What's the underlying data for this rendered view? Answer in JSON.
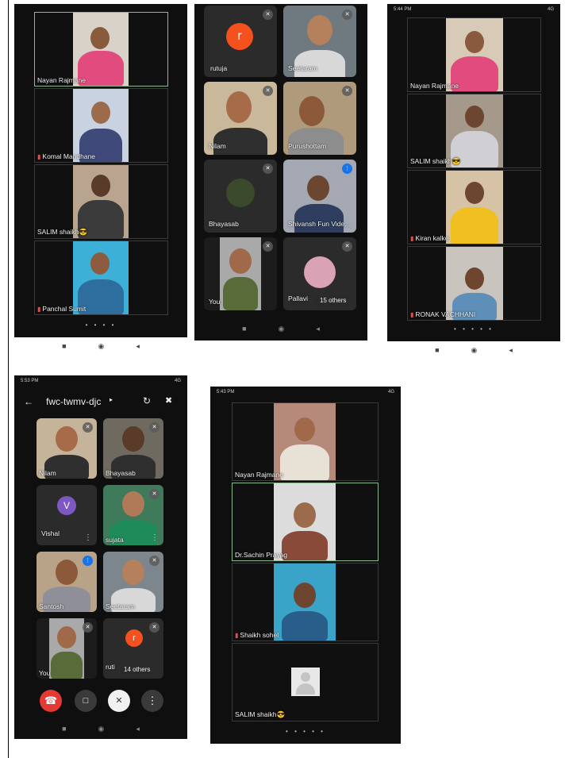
{
  "phone1": {
    "tiles": [
      {
        "name": "Nayan Rajmane"
      },
      {
        "name": "Komal Mandhane"
      },
      {
        "name": "SALIM shaikh😎"
      },
      {
        "name": "Panchal Sumit"
      }
    ],
    "page_dots": "• • • •"
  },
  "phone2": {
    "tiles": [
      {
        "name": "rutuja",
        "initial": "r"
      },
      {
        "name": "Seetaram"
      },
      {
        "name": "Nilam"
      },
      {
        "name": "Purushottam"
      },
      {
        "name": "Bhayasab"
      },
      {
        "name": "Shivansh Fun Vide..."
      },
      {
        "name": "You"
      },
      {
        "name": "Pallavi"
      }
    ],
    "others": "15 others"
  },
  "phone3": {
    "status_time": "5:44 PM",
    "status_right": "4G",
    "tiles": [
      {
        "name": "Nayan Rajmane"
      },
      {
        "name": "SALIM shaikh😎"
      },
      {
        "name": "Kiran kalke"
      },
      {
        "name": "RONAK VACHHANI"
      }
    ],
    "page_dots": "• • • • •"
  },
  "phone4": {
    "status_time": "5:53 PM",
    "status_right": "4G",
    "meeting_code": "fwc-twmv-djc",
    "tiles": [
      {
        "name": "Nilam"
      },
      {
        "name": "Bhayasab"
      },
      {
        "name": "Vishal",
        "initial": "V"
      },
      {
        "name": "sujata"
      },
      {
        "name": "Santosh"
      },
      {
        "name": "Seetaram"
      },
      {
        "name": "You"
      },
      {
        "name": "rutuja",
        "initial": "r"
      }
    ],
    "others": "14 others",
    "rutuja_short": "ruti"
  },
  "phone5": {
    "status_time": "5:43 PM",
    "status_right": "4G",
    "tiles": [
      {
        "name": "Nayan Rajmane"
      },
      {
        "name": "Dr.Sachin Prayag"
      },
      {
        "name": "Shaikh sohel"
      },
      {
        "name": "SALIM shaikh😎"
      }
    ],
    "page_dots": "• • • • •"
  },
  "icons": {
    "mic_off": "🎙",
    "pin": "📌",
    "nav_square": "■",
    "nav_circle": "◉",
    "nav_back": "◂"
  },
  "colors": {
    "avatar_orange": "#f4511e",
    "avatar_purple": "#7e57c2",
    "end_call_red": "#e53935",
    "speaking_blue": "#1a73e8"
  }
}
